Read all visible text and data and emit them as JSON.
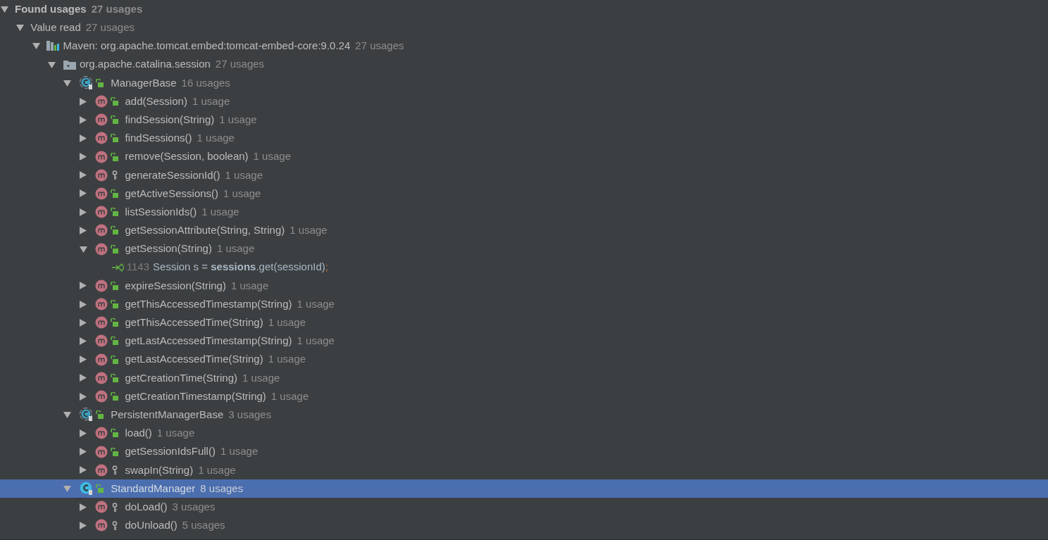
{
  "tree": [
    {
      "kind": "group",
      "label": "Found usages",
      "count": "27 usages",
      "expanded": true,
      "selected": false,
      "children": [
        {
          "kind": "group",
          "label": "Value read",
          "count": "27 usages",
          "expanded": true,
          "selected": false,
          "children": [
            {
              "kind": "library",
              "label": "Maven: org.apache.tomcat.embed:tomcat-embed-core:9.0.24",
              "count": "27 usages",
              "expanded": true,
              "selected": false,
              "children": [
                {
                  "kind": "package",
                  "label": "org.apache.catalina.session",
                  "count": "27 usages",
                  "expanded": true,
                  "selected": false,
                  "children": [
                    {
                      "kind": "class",
                      "abstract": true,
                      "public": true,
                      "label": "ManagerBase",
                      "count": "16 usages",
                      "expanded": true,
                      "selected": false,
                      "children": [
                        {
                          "kind": "method",
                          "public": true,
                          "label": "add(Session)",
                          "count": "1 usage",
                          "expanded": false,
                          "selected": false
                        },
                        {
                          "kind": "method",
                          "public": true,
                          "label": "findSession(String)",
                          "count": "1 usage",
                          "expanded": false,
                          "selected": false
                        },
                        {
                          "kind": "method",
                          "public": true,
                          "label": "findSessions()",
                          "count": "1 usage",
                          "expanded": false,
                          "selected": false
                        },
                        {
                          "kind": "method",
                          "public": true,
                          "label": "remove(Session, boolean)",
                          "count": "1 usage",
                          "expanded": false,
                          "selected": false
                        },
                        {
                          "kind": "method",
                          "public": false,
                          "label": "generateSessionId()",
                          "count": "1 usage",
                          "expanded": false,
                          "selected": false
                        },
                        {
                          "kind": "method",
                          "public": true,
                          "label": "getActiveSessions()",
                          "count": "1 usage",
                          "expanded": false,
                          "selected": false
                        },
                        {
                          "kind": "method",
                          "public": true,
                          "label": "listSessionIds()",
                          "count": "1 usage",
                          "expanded": false,
                          "selected": false
                        },
                        {
                          "kind": "method",
                          "public": true,
                          "label": "getSessionAttribute(String, String)",
                          "count": "1 usage",
                          "expanded": false,
                          "selected": false
                        },
                        {
                          "kind": "method",
                          "public": true,
                          "label": "getSession(String)",
                          "count": "1 usage",
                          "expanded": true,
                          "selected": false,
                          "children": [
                            {
                              "kind": "usage",
                              "line": "1143",
                              "code": "Session s = **sessions**.get(sessionId)",
                              "punct": ";",
                              "selected": false
                            }
                          ]
                        },
                        {
                          "kind": "method",
                          "public": true,
                          "label": "expireSession(String)",
                          "count": "1 usage",
                          "expanded": false,
                          "selected": false
                        },
                        {
                          "kind": "method",
                          "public": true,
                          "label": "getThisAccessedTimestamp(String)",
                          "count": "1 usage",
                          "expanded": false,
                          "selected": false
                        },
                        {
                          "kind": "method",
                          "public": true,
                          "label": "getThisAccessedTime(String)",
                          "count": "1 usage",
                          "expanded": false,
                          "selected": false
                        },
                        {
                          "kind": "method",
                          "public": true,
                          "label": "getLastAccessedTimestamp(String)",
                          "count": "1 usage",
                          "expanded": false,
                          "selected": false
                        },
                        {
                          "kind": "method",
                          "public": true,
                          "label": "getLastAccessedTime(String)",
                          "count": "1 usage",
                          "expanded": false,
                          "selected": false
                        },
                        {
                          "kind": "method",
                          "public": true,
                          "label": "getCreationTime(String)",
                          "count": "1 usage",
                          "expanded": false,
                          "selected": false
                        },
                        {
                          "kind": "method",
                          "public": true,
                          "label": "getCreationTimestamp(String)",
                          "count": "1 usage",
                          "expanded": false,
                          "selected": false
                        }
                      ]
                    },
                    {
                      "kind": "class",
                      "abstract": true,
                      "public": true,
                      "label": "PersistentManagerBase",
                      "count": "3 usages",
                      "expanded": true,
                      "selected": false,
                      "children": [
                        {
                          "kind": "method",
                          "public": true,
                          "label": "load()",
                          "count": "1 usage",
                          "expanded": false,
                          "selected": false
                        },
                        {
                          "kind": "method",
                          "public": true,
                          "label": "getSessionIdsFull()",
                          "count": "1 usage",
                          "expanded": false,
                          "selected": false
                        },
                        {
                          "kind": "method",
                          "public": false,
                          "label": "swapIn(String)",
                          "count": "1 usage",
                          "expanded": false,
                          "selected": false
                        }
                      ]
                    },
                    {
                      "kind": "class",
                      "abstract": false,
                      "public": true,
                      "label": "StandardManager",
                      "count": "8 usages",
                      "expanded": true,
                      "selected": true,
                      "children": [
                        {
                          "kind": "method",
                          "public": false,
                          "label": "doLoad()",
                          "count": "3 usages",
                          "expanded": false,
                          "selected": false
                        },
                        {
                          "kind": "method",
                          "public": false,
                          "label": "doUnload()",
                          "count": "5 usages",
                          "expanded": false,
                          "selected": false
                        }
                      ]
                    }
                  ]
                }
              ]
            }
          ]
        }
      ]
    }
  ]
}
